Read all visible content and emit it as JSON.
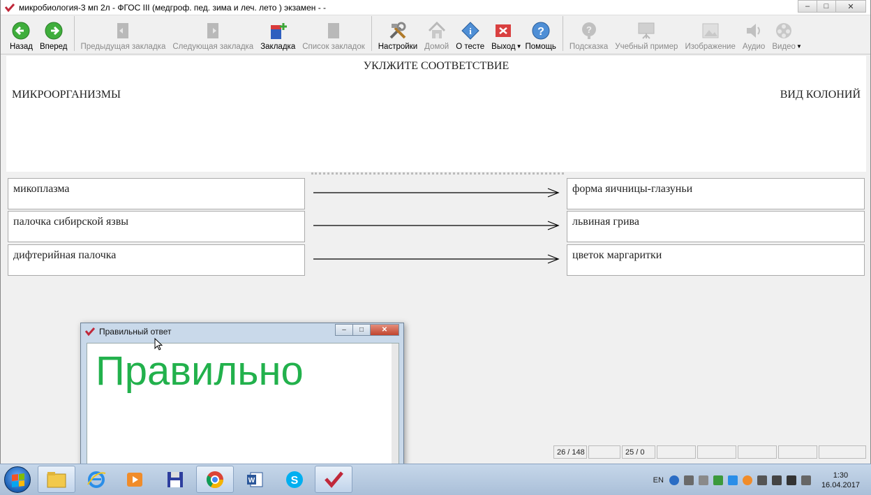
{
  "window": {
    "title": "микробиология-3 мп 2л - ФГОС III (медгроф. пед. зима и леч. лето ) экзамен -  -"
  },
  "toolbar": {
    "back": "Назад",
    "forward": "Вперед",
    "prev_bookmark": "Предыдущая закладка",
    "next_bookmark": "Следующая закладка",
    "bookmark": "Закладка",
    "bookmark_list": "Список закладок",
    "settings": "Настройки",
    "home": "Домой",
    "about_test": "О тесте",
    "exit": "Выход",
    "help": "Помощь",
    "hint": "Подсказка",
    "training_example": "Учебный пример",
    "image": "Изображение",
    "audio": "Аудио",
    "video": "Видео"
  },
  "question": {
    "title": "УКЛЖИТЕ СООТВЕТСТВИЕ",
    "left_header": "МИКРООРГАНИЗМЫ",
    "right_header": "ВИД КОЛОНИЙ",
    "pairs": [
      {
        "left": "микоплазма",
        "right": "форма яичницы-глазуньи"
      },
      {
        "left": "палочка сибирской язвы",
        "right": "львиная грива"
      },
      {
        "left": "дифтерийная палочка",
        "right": "цветок маргаритки"
      }
    ]
  },
  "status": {
    "progress": "26 / 148",
    "score": "25 / 0"
  },
  "dialog": {
    "title": "Правильный ответ",
    "result": "Правильно",
    "result_color": "#22b14c"
  },
  "taskbar": {
    "lang": "EN",
    "time": "1:30",
    "date": "16.04.2017"
  }
}
